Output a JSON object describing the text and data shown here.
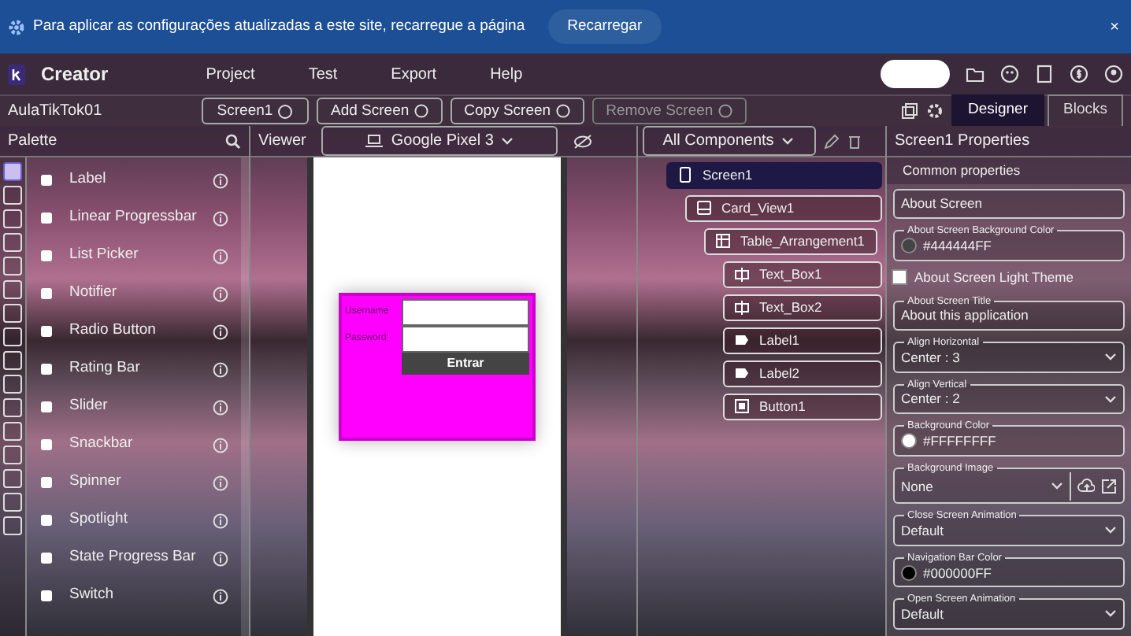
{
  "banner": {
    "message": "Para aplicar as configurações atualizadas a este site, recarregue a página",
    "button": "Recarregar",
    "close": "×"
  },
  "header": {
    "brand": "Creator",
    "menu": [
      "Project",
      "Test",
      "Export",
      "Help"
    ]
  },
  "toolbar": {
    "project": "AulaTikTok01",
    "screen": "Screen1",
    "buttons": [
      {
        "label": "Add Screen",
        "disabled": false
      },
      {
        "label": "Copy Screen",
        "disabled": false
      },
      {
        "label": "Remove Screen",
        "disabled": true
      }
    ],
    "modes": [
      {
        "label": "Designer",
        "selected": true
      },
      {
        "label": "Blocks",
        "selected": false
      }
    ]
  },
  "palette": {
    "title": "Palette",
    "categories": [
      {
        "selected": true
      },
      {
        "selected": false
      },
      {
        "selected": false
      },
      {
        "selected": false
      },
      {
        "selected": false
      },
      {
        "selected": false
      },
      {
        "selected": false
      },
      {
        "selected": false
      },
      {
        "selected": false
      },
      {
        "selected": false
      },
      {
        "selected": false
      },
      {
        "selected": false
      },
      {
        "selected": false
      },
      {
        "selected": false
      },
      {
        "selected": false
      },
      {
        "selected": false
      }
    ],
    "items": [
      "Label",
      "Linear Progressbar",
      "List Picker",
      "Notifier",
      "Radio Button",
      "Rating Bar",
      "Slider",
      "Snackbar",
      "Spinner",
      "Spotlight",
      "State Progress Bar",
      "Switch"
    ]
  },
  "viewer": {
    "title": "Viewer",
    "device": "Google Pixel 3",
    "form": {
      "fields": [
        {
          "label": "Username"
        },
        {
          "label": "Password"
        }
      ],
      "button": "Entrar"
    }
  },
  "components": {
    "filter": "All Components",
    "tree": [
      {
        "name": "Screen1",
        "kind": "screen",
        "selected": true,
        "children": [
          {
            "name": "Card_View1",
            "kind": "card",
            "selected": false,
            "children": [
              {
                "name": "Table_Arrangement1",
                "kind": "table",
                "selected": false,
                "children": [
                  {
                    "name": "Text_Box1",
                    "kind": "textbox",
                    "selected": false
                  },
                  {
                    "name": "Text_Box2",
                    "kind": "textbox",
                    "selected": false
                  },
                  {
                    "name": "Label1",
                    "kind": "label",
                    "selected": false
                  },
                  {
                    "name": "Label2",
                    "kind": "label",
                    "selected": false
                  },
                  {
                    "name": "Button1",
                    "kind": "button",
                    "selected": false
                  }
                ]
              }
            ]
          }
        ]
      }
    ]
  },
  "properties": {
    "title": "Screen1 Properties",
    "section": "Common properties",
    "items": [
      {
        "kind": "text",
        "value": "About Screen"
      },
      {
        "kind": "color",
        "legend": "About Screen Background Color",
        "value": "#444444FF",
        "color": "#444444"
      },
      {
        "kind": "checkbox",
        "label": "About Screen Light Theme",
        "checked": false
      },
      {
        "kind": "text",
        "legend": "About Screen Title",
        "value": "About this application"
      },
      {
        "kind": "select",
        "legend": "Align Horizontal",
        "value": "Center : 3"
      },
      {
        "kind": "select",
        "legend": "Align Vertical",
        "value": "Center : 2"
      },
      {
        "kind": "color",
        "legend": "Background Color",
        "value": "#FFFFFFFF",
        "color": "#ffffff"
      },
      {
        "kind": "image",
        "legend": "Background Image",
        "value": "None"
      },
      {
        "kind": "select",
        "legend": "Close Screen Animation",
        "value": "Default"
      },
      {
        "kind": "color",
        "legend": "Navigation Bar Color",
        "value": "#000000FF",
        "color": "#000000"
      },
      {
        "kind": "select",
        "legend": "Open Screen Animation",
        "value": "Default"
      }
    ]
  }
}
